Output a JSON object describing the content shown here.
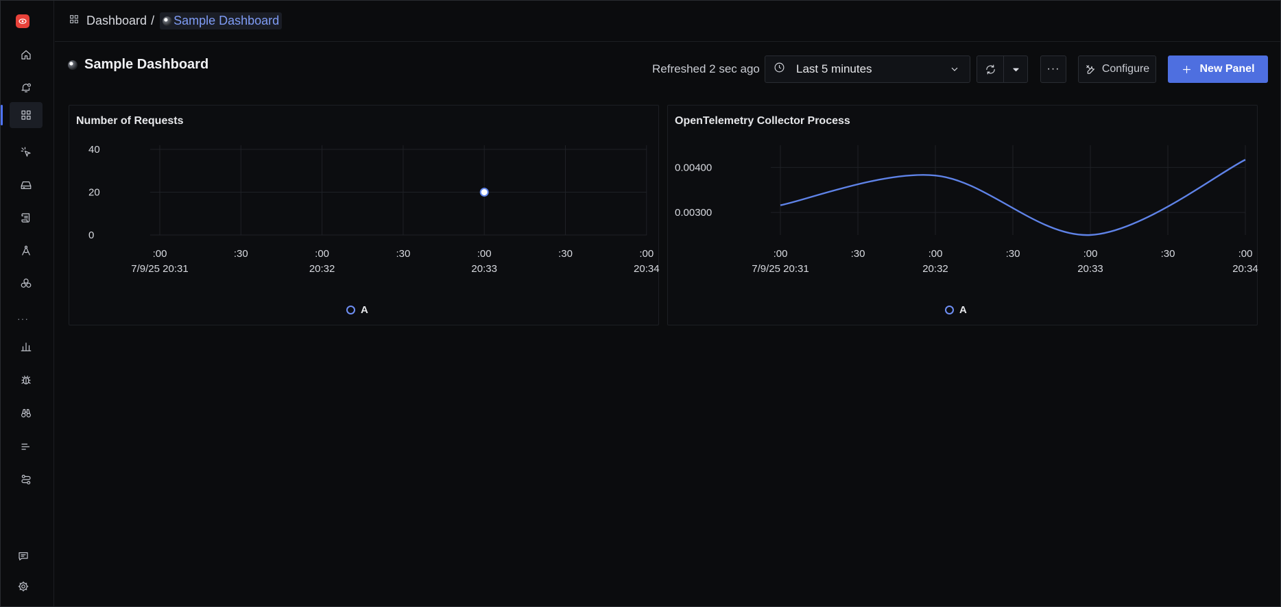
{
  "breadcrumb": {
    "root": "Dashboard",
    "separator": "/",
    "current": "Sample Dashboard"
  },
  "page": {
    "title": "Sample Dashboard"
  },
  "toolbar": {
    "refreshed": "Refreshed 2 sec ago",
    "time_range": "Last 5 minutes",
    "more_label": "···",
    "configure_label": "Configure",
    "new_panel_label": "New Panel"
  },
  "sidebar": {
    "items": [
      "home-icon",
      "alerts-icon",
      "dashboards-icon",
      "pointer-icon",
      "drive-icon",
      "scroll-icon",
      "compass-icon",
      "services-icon"
    ],
    "more": "···",
    "items2": [
      "chart-icon",
      "bug-icon",
      "binoculars-icon",
      "list-icon",
      "pipeline-icon"
    ],
    "bottom": [
      "chat-icon",
      "settings-icon"
    ]
  },
  "colors": {
    "accent": "#4e6fe0",
    "series": "#5f83e8"
  },
  "chart_data": [
    {
      "type": "scatter",
      "title": "Number of Requests",
      "ylim": [
        0,
        40
      ],
      "yticks": [
        "40",
        "20",
        "0"
      ],
      "xticks": [
        {
          "top": ":00",
          "bottom": "7/9/25 20:31"
        },
        {
          "top": ":30",
          "bottom": ""
        },
        {
          "top": ":00",
          "bottom": "20:32"
        },
        {
          "top": ":30",
          "bottom": ""
        },
        {
          "top": ":00",
          "bottom": "20:33"
        },
        {
          "top": ":30",
          "bottom": ""
        },
        {
          "top": ":00",
          "bottom": "20:34"
        }
      ],
      "series": [
        {
          "name": "A",
          "points": [
            {
              "x": "20:33:00",
              "y": 20
            }
          ]
        }
      ]
    },
    {
      "type": "line",
      "title": "OpenTelemetry Collector Process",
      "ylim": [
        0.0025,
        0.0044
      ],
      "yticks": [
        "0.00400",
        "0.00300"
      ],
      "xticks": [
        {
          "top": ":00",
          "bottom": "7/9/25 20:31"
        },
        {
          "top": ":30",
          "bottom": ""
        },
        {
          "top": ":00",
          "bottom": "20:32"
        },
        {
          "top": ":30",
          "bottom": ""
        },
        {
          "top": ":00",
          "bottom": "20:33"
        },
        {
          "top": ":30",
          "bottom": ""
        },
        {
          "top": ":00",
          "bottom": "20:34"
        }
      ],
      "series": [
        {
          "name": "A",
          "points": [
            {
              "x": "20:31:00",
              "y": 0.00316
            },
            {
              "x": "20:32:00",
              "y": 0.00382
            },
            {
              "x": "20:33:00",
              "y": 0.0025
            },
            {
              "x": "20:34:00",
              "y": 0.00417
            }
          ]
        }
      ]
    }
  ]
}
